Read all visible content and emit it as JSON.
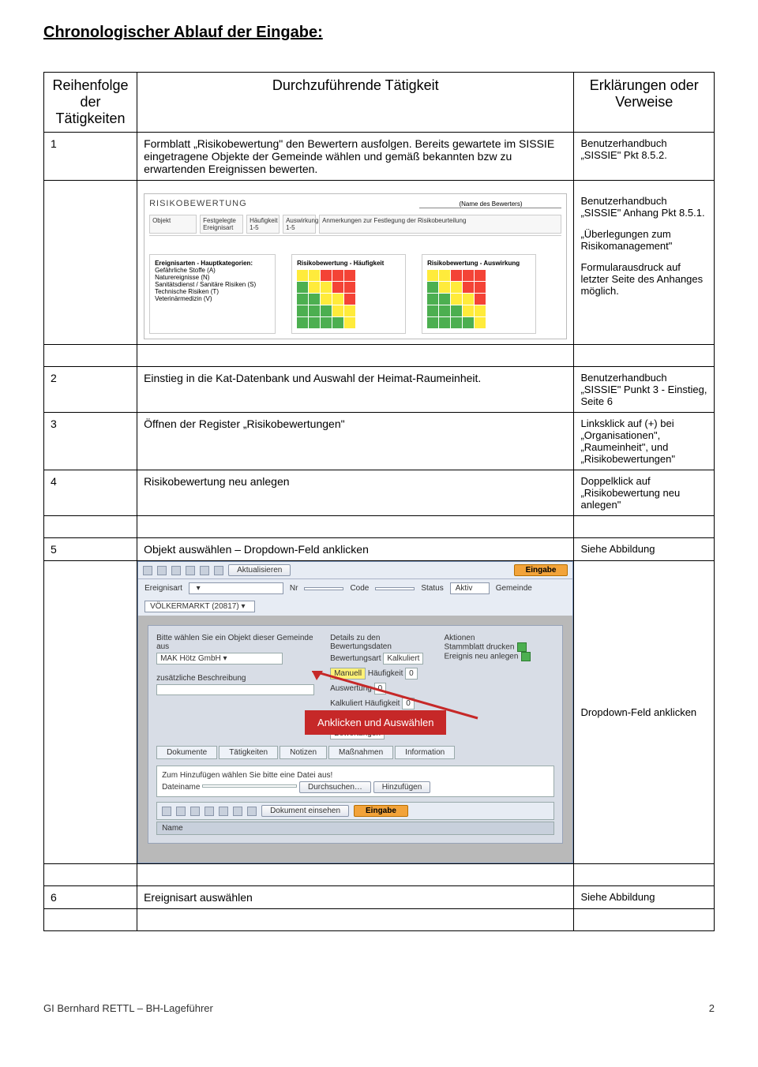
{
  "title": "Chronologischer Ablauf der Eingabe:",
  "header": {
    "col1": "Reihenfolge der Tätigkeiten",
    "col2": "Durchzuführende Tätigkeit",
    "col3": "Erklärungen oder Verweise"
  },
  "rows": {
    "r1": {
      "num": "1",
      "activity": "Formblatt „Risikobewertung\" den Bewertern ausfolgen. Bereits gewartete im SISSIE eingetragene Objekte der Gemeinde wählen und gemäß bekannten bzw zu erwartenden Ereignissen bewerten.",
      "exp": "Benutzerhandbuch „SISSIE\" Pkt 8.5.2."
    },
    "r1b": {
      "exp1": "Benutzerhandbuch „SISSIE\" Anhang Pkt 8.5.1.",
      "exp2": "„Überlegungen zum Risikomanagement\"",
      "exp3": "Formularausdruck auf letzter Seite des Anhanges möglich."
    },
    "r2": {
      "num": "2",
      "activity": "Einstieg in die Kat-Datenbank und Auswahl der Heimat-Raumeinheit.",
      "exp": "Benutzerhandbuch „SISSIE\" Punkt 3 - Einstieg, Seite 6"
    },
    "r3": {
      "num": "3",
      "activity": "Öffnen der Register „Risikobewertungen\"",
      "exp": "Linksklick auf (+) bei „Organisationen\", „Raumeinheit\", und „Risikobewertungen\""
    },
    "r4": {
      "num": "4",
      "activity": "Risikobewertung neu anlegen",
      "exp": "Doppelklick auf „Risikobewertung neu anlegen\""
    },
    "r5": {
      "num": "5",
      "activity": "Objekt auswählen – Dropdown-Feld anklicken",
      "exp": "Siehe Abbildung"
    },
    "r5b": {
      "exp": "Dropdown-Feld anklicken"
    },
    "r6": {
      "num": "6",
      "activity": "Ereignisart auswählen",
      "exp": "Siehe Abbildung"
    }
  },
  "embedded_form": {
    "title": "RISIKOBEWERTUNG",
    "name_label": "(Name des Bewerters)",
    "cols": [
      "Objekt",
      "Festgelegte Ereignisart",
      "Häufigkeit 1-5",
      "Auswirkung 1-5",
      "Anmerkungen zur Festlegung der Risikobeurteilung"
    ],
    "cat_title": "Ereignisarten - Hauptkategorien:",
    "cats": [
      "Gefährliche Stoffe (A)",
      "Naturereignisse (N)",
      "Sanitätsdienst / Sanitäre Risiken (S)",
      "Technische Risiken (T)",
      "Veterinärmedizin (V)"
    ],
    "chart1": "Risikobewertung - Häufigkeit",
    "chart2": "Risikobewertung - Auswirkung"
  },
  "app": {
    "btn_update": "Aktualisieren",
    "tab_input": "Eingabe",
    "lbl_ereignisart": "Ereignisart",
    "lbl_nr": "Nr",
    "lbl_code": "Code",
    "lbl_status": "Status",
    "val_status": "Aktiv",
    "lbl_gemeinde": "Gemeinde",
    "val_gemeinde": "VÖLKERMARKT (20817)",
    "prompt": "Bitte wählen Sie ein Objekt dieser Gemeinde aus",
    "obj": "MAK Hötz GmbH",
    "extra": "zusätzliche Beschreibung",
    "detail_title": "Details zu den Bewertungsdaten",
    "lbl_bewart": "Bewertungsart",
    "val_bewart": "Kalkuliert",
    "lbl_manuell": "Manuell",
    "lbl_haeuf": "Häufigkeit",
    "lbl_ausw": "Auswertung",
    "lbl_kalk": "Kalkuliert",
    "val_zero": "0",
    "lbl_bew": "Bewertungen",
    "actions_title": "Aktionen",
    "act1": "Stammblatt drucken",
    "act2": "Ereignis neu anlegen",
    "tabs": [
      "Dokumente",
      "Tätigkeiten",
      "Notizen",
      "Maßnahmen",
      "Information"
    ],
    "hint": "Zum Hinzufügen wählen Sie bitte eine Datei aus!",
    "lbl_dateiname": "Dateiname",
    "btn_browse": "Durchsuchen…",
    "btn_add": "Hinzufügen",
    "btn_doc": "Dokument einsehen",
    "lbl_name": "Name",
    "callout": "Anklicken und Auswählen"
  },
  "footer": {
    "left": "GI Bernhard RETTL – BH-Lageführer",
    "right": "2"
  }
}
